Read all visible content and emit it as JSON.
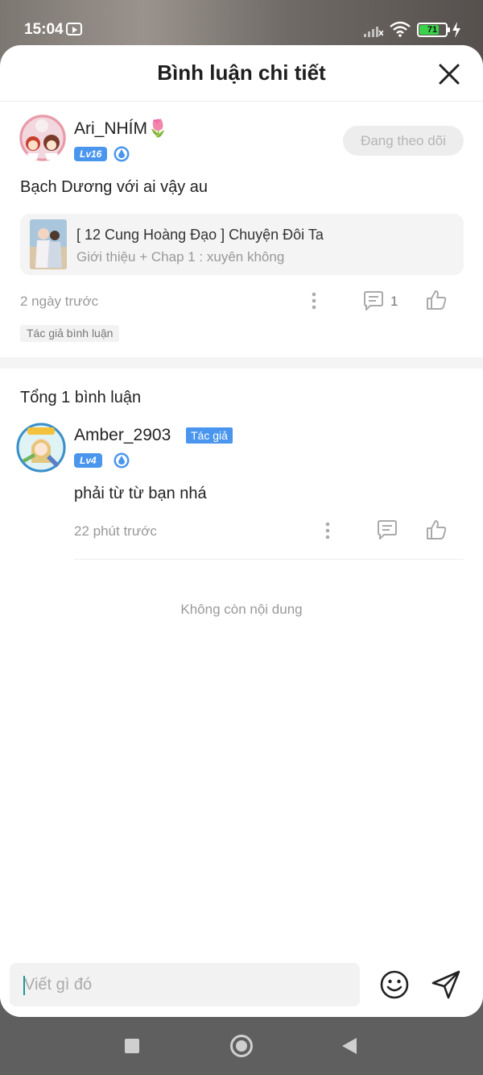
{
  "status_bar": {
    "time": "15:04",
    "battery": "71",
    "icons": [
      "app-icon",
      "signal-icon",
      "wifi-icon",
      "battery-icon",
      "charging-icon"
    ]
  },
  "header": {
    "title": "Bình luận chi tiết",
    "close_icon": "close-icon"
  },
  "post": {
    "author_name": "Ari_NHÍM🌷",
    "level": "Lv16",
    "follow_label": "Đang theo dõi",
    "text": "Bạch Dương với ai vậy au",
    "story": {
      "title": "[ 12 Cung Hoàng Đạo ] Chuyện Đôi Ta",
      "chapter": "Giới thiệu + Chap 1 : xuyên không"
    },
    "time": "2 ngày trước",
    "reply_count": "1",
    "tag": "Tác giả bình luận"
  },
  "replies": {
    "total_label": "Tổng 1 bình luận",
    "items": [
      {
        "author_name": "Amber_2903",
        "author_tag": "Tác giả",
        "level": "Lv4",
        "text": "phải từ từ bạn nhá",
        "time": "22 phút trước"
      }
    ],
    "end_label": "Không còn nội dung"
  },
  "input": {
    "placeholder": "Viết gì đó"
  },
  "colors": {
    "accent": "#4a96ee",
    "caret": "#1d9b91",
    "muted_text": "#999999"
  }
}
